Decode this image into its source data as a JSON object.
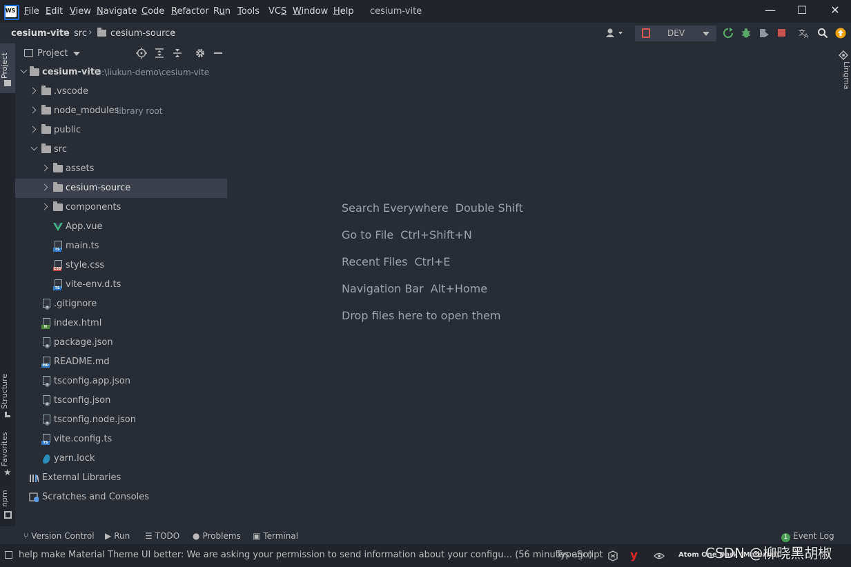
{
  "app": {
    "logo_text": "WS",
    "window_title": "cesium-vite",
    "menu": [
      {
        "label": "File",
        "mnemonic": "F"
      },
      {
        "label": "Edit",
        "mnemonic": "E"
      },
      {
        "label": "View",
        "mnemonic": "V"
      },
      {
        "label": "Navigate",
        "mnemonic": "N"
      },
      {
        "label": "Code",
        "mnemonic": "C"
      },
      {
        "label": "Refactor",
        "mnemonic": "R"
      },
      {
        "label": "Run",
        "mnemonic": "u"
      },
      {
        "label": "Tools",
        "mnemonic": "T"
      },
      {
        "label": "VCS",
        "mnemonic": "S"
      },
      {
        "label": "Window",
        "mnemonic": "W"
      },
      {
        "label": "Help",
        "mnemonic": "H"
      }
    ]
  },
  "breadcrumb": {
    "project": "cesium-vite",
    "folder1": "src",
    "folder2": "cesium-source"
  },
  "run_config": {
    "label": "DEV"
  },
  "toolbar_icons": [
    "user-icon",
    "run-icon",
    "debug-icon",
    "coverage-icon",
    "stop-icon",
    "translate-icon",
    "search-icon",
    "update-icon"
  ],
  "side_tabs": {
    "project": "Project",
    "structure": "Structure",
    "favorites": "Favorites",
    "npm": "npm",
    "lingma": "Lingma"
  },
  "project_panel": {
    "title": "Project",
    "root": {
      "name": "cesium-vite",
      "path": "D:\\liukun-demo\\cesium-vite"
    },
    "items": [
      {
        "label": ".vscode"
      },
      {
        "label": "node_modules",
        "hint": "library root"
      },
      {
        "label": "public"
      },
      {
        "label": "src"
      },
      {
        "label": "assets"
      },
      {
        "label": "cesium-source"
      },
      {
        "label": "components"
      },
      {
        "label": "App.vue"
      },
      {
        "label": "main.ts"
      },
      {
        "label": "style.css"
      },
      {
        "label": "vite-env.d.ts"
      },
      {
        "label": ".gitignore"
      },
      {
        "label": "index.html"
      },
      {
        "label": "package.json"
      },
      {
        "label": "README.md"
      },
      {
        "label": "tsconfig.app.json"
      },
      {
        "label": "tsconfig.json"
      },
      {
        "label": "tsconfig.node.json"
      },
      {
        "label": "vite.config.ts"
      },
      {
        "label": "yarn.lock"
      },
      {
        "label": "External Libraries"
      },
      {
        "label": "Scratches and Consoles"
      }
    ]
  },
  "editor_hints": [
    {
      "action": "Search Everywhere",
      "key": "Double Shift"
    },
    {
      "action": "Go to File",
      "key": "Ctrl+Shift+N"
    },
    {
      "action": "Recent Files",
      "key": "Ctrl+E"
    },
    {
      "action": "Navigation Bar",
      "key": "Alt+Home"
    },
    {
      "action": "Drop files here to open them",
      "key": ""
    }
  ],
  "bottom_tools": {
    "version_control": "Version Control",
    "run": "Run",
    "todo": "TODO",
    "problems": "Problems",
    "terminal": "Terminal",
    "event_log": "Event Log",
    "event_log_count": "1"
  },
  "status": {
    "message": "help make Material Theme UI better: We are asking your permission to send information about your configu... (56 minutes ago)",
    "language": "TypeScript",
    "theme": "Atom One Dark (Material)"
  },
  "watermark": "CSDN @柳晓黑胡椒"
}
